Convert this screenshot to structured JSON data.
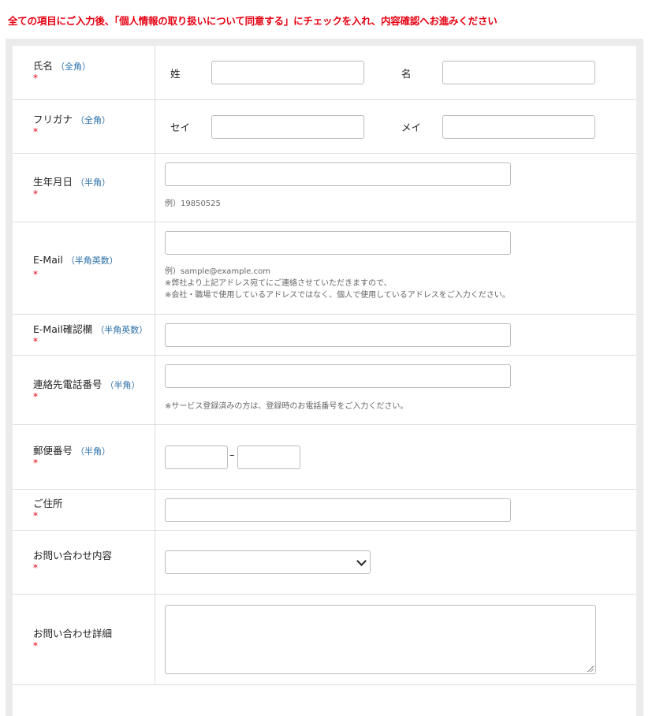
{
  "notice": "全ての項目にご入力後、「個人情報の取り扱いについて同意する」にチェックを入れ、内容確認へお進みください",
  "required_mark": "*",
  "fields": {
    "name": {
      "label": "氏名",
      "tag": "（全角）",
      "last_label": "姓",
      "first_label": "名",
      "last_value": "",
      "first_value": ""
    },
    "kana": {
      "label": "フリガナ",
      "tag": "（全角）",
      "last_label": "セイ",
      "first_label": "メイ",
      "last_value": "",
      "first_value": ""
    },
    "birthday": {
      "label": "生年月日",
      "tag": "（半角）",
      "value": "",
      "hint": "例）19850525"
    },
    "email": {
      "label": "E-Mail",
      "tag": "（半角英数）",
      "value": "",
      "hint1": "例）sample@example.com",
      "hint2": "※弊社より上記アドレス宛てにご連絡させていただきますので、",
      "hint3": "※会社・職場で使用しているアドレスではなく、個人で使用しているアドレスをご入力ください。"
    },
    "email_confirm": {
      "label": "E-Mail確認欄",
      "tag": "（半角英数）",
      "value": ""
    },
    "phone": {
      "label": "連絡先電話番号",
      "tag": "（半角）",
      "value": "",
      "hint": "※サービス登録済みの方は、登録時のお電話番号をご入力ください。"
    },
    "postal": {
      "label": "郵便番号",
      "tag": "（半角）",
      "value1": "",
      "value2": "",
      "separator": "–"
    },
    "address": {
      "label": "ご住所",
      "value": ""
    },
    "inquiry_type": {
      "label": "お問い合わせ内容",
      "selected": ""
    },
    "inquiry_detail": {
      "label": "お問い合わせ詳細",
      "value": ""
    }
  }
}
